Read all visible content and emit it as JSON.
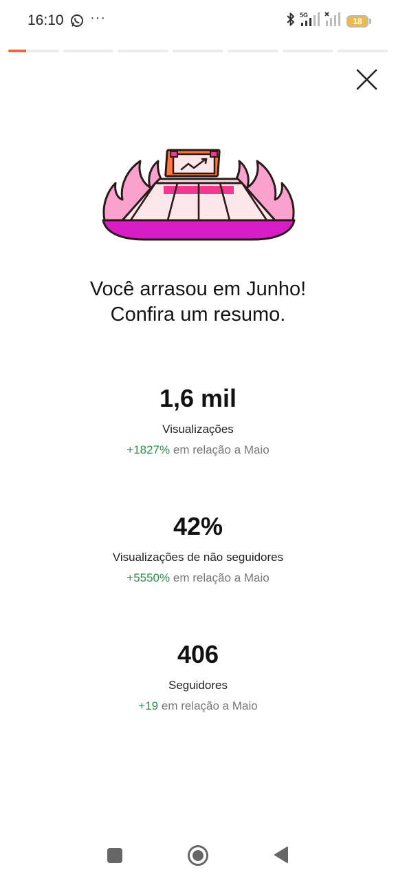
{
  "status_bar": {
    "time": "16:10",
    "battery_level": "18",
    "network": "5G",
    "icons": [
      "whatsapp-icon",
      "more-icon",
      "bluetooth-icon",
      "signal-icon",
      "signal-icon-2",
      "battery-icon"
    ]
  },
  "story_progress": {
    "segments": 7,
    "active_index": 0,
    "active_fraction": 0.35,
    "active_color": "#ef6a3a"
  },
  "headline": {
    "line1": "Você arrasou em Junho!",
    "line2": "Confira um resumo."
  },
  "stats": [
    {
      "value": "1,6 mil",
      "label": "Visualizações",
      "delta": "+1827%",
      "comparison": "em relação a Maio"
    },
    {
      "value": "42%",
      "label": "Visualizações de não seguidores",
      "delta": "+5550%",
      "comparison": "em relação a Maio"
    },
    {
      "value": "406",
      "label": "Seguidores",
      "delta": "+19",
      "comparison": "em relação a Maio"
    }
  ],
  "colors": {
    "delta_positive": "#2e8b4e",
    "accent_pink": "#f9a2cd",
    "accent_magenta": "#d81cc6"
  },
  "nav_bar": {
    "icons": [
      "recent-apps-icon",
      "home-icon",
      "back-icon"
    ]
  }
}
